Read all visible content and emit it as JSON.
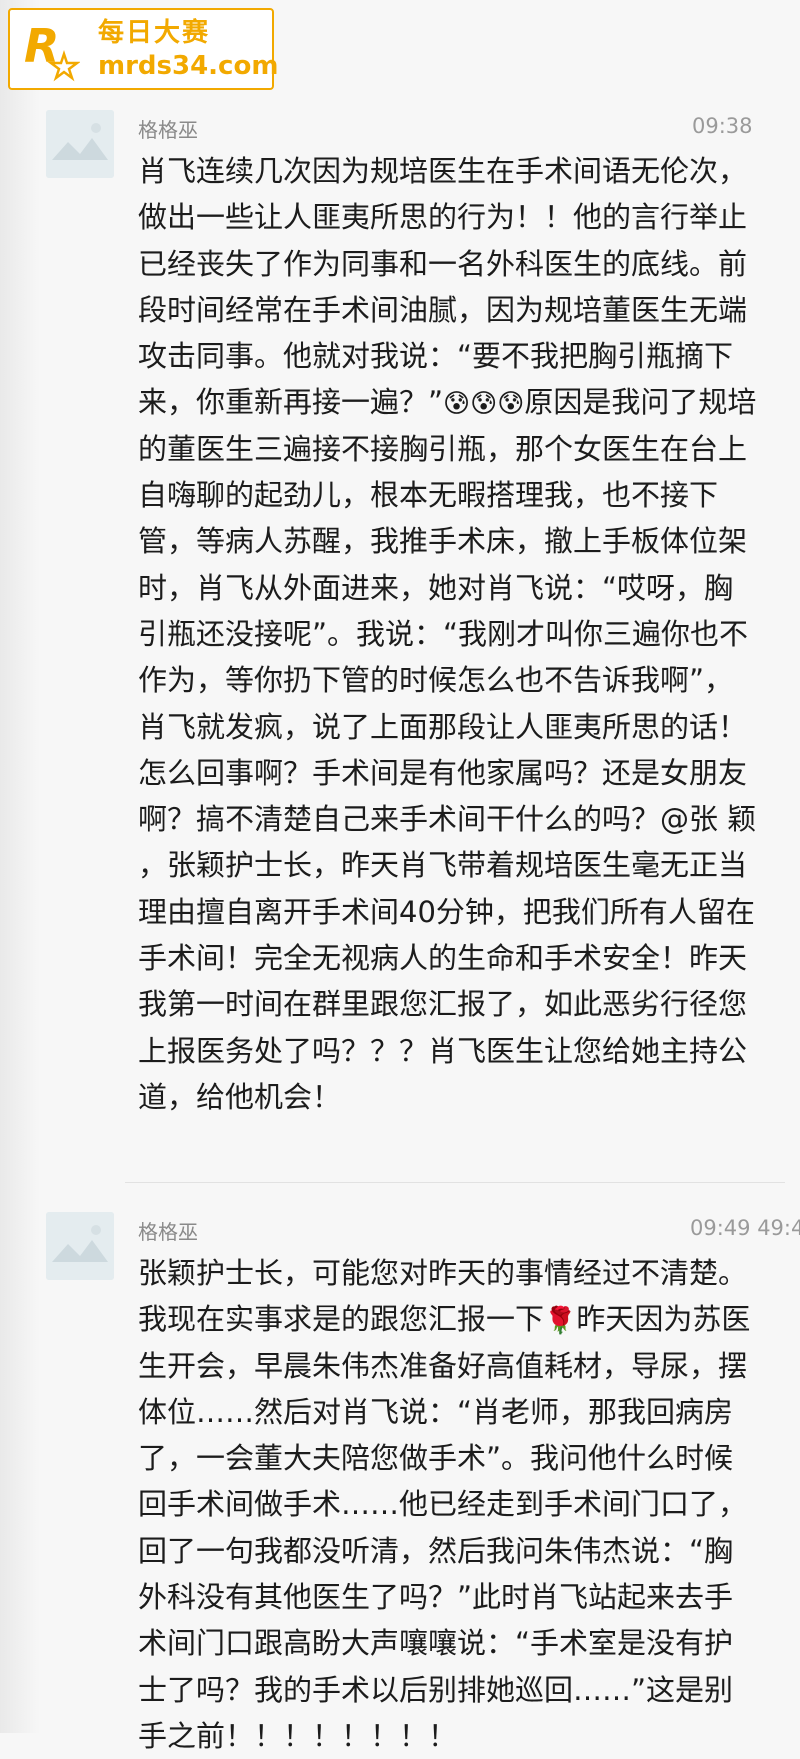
{
  "watermark": {
    "title": "每日大赛",
    "url": "mrds34.com"
  },
  "messages": [
    {
      "sender": "格格巫",
      "time": "09:38",
      "text_1": "肖飞连续几次因为规培医生在手术间语无伦次，做出一些让人匪夷所思的行为！！他的言行举止已经丧失了作为同事和一名外科医生的底线。前段时间经常在手术间油腻，因为规培董医生无端攻击同事。他就对我说：“要不我把胸引瓶摘下来，你重新再接一遍？”",
      "emoji": "😰😰😰",
      "text_2": "原因是我问了规培的董医生三遍接不接胸引瓶，那个女医生在台上自嗨聊的起劲儿，根本无暇搭理我，也不接下管，等病人苏醒，我推手术床，撤上手板体位架时，肖飞从外面进来，她对肖飞说：“哎呀，胸引瓶还没接呢”。我说：“我刚才叫你三遍你也不作为，等你扔下管的时候怎么也不告诉我啊”，肖飞就发疯，说了上面那段让人匪夷所思的话！怎么回事啊？手术间是有他家属吗？还是女朋友啊？搞不清楚自己来手术间干什么的吗？@张 颖 ，张颖护士长，昨天肖飞带着规培医生毫无正当理由擅自离开手术间40分钟，把我们所有人留在手术间！完全无视病人的生命和手术安全！昨天我第一时间在群里跟您汇报了，如此恶劣行径您上报医务处了吗？？？肖飞医生让您给她主持公道，给他机会！"
    },
    {
      "sender": "格格巫",
      "time": "09:49 49:4",
      "text_1": "张颖护士长，可能您对昨天的事情经过不清楚。我现在实事求是的跟您汇报一下",
      "emoji": "🌹",
      "text_2": "昨天因为苏医生开会，早晨朱伟杰准备好高值耗材，导尿，摆体位……然后对肖飞说：“肖老师，那我回病房了，一会董大夫陪您做手术”。我问他什么时候回手术间做手术……他已经走到手术间门口了，回了一句我都没听清，然后我问朱伟杰说：“胸外科没有其他医生了吗？”此时肖飞站起来去手术间门口跟高盼大声嚷嚷说：“手术室是没有护士了吗？我的手术以后别排她巡回……”这是别手之前！！！！！！！！"
    }
  ],
  "colors": {
    "watermark": "#f2a900",
    "text": "#1c1c1c",
    "meta": "#8a8a8a",
    "background": "#f7f7f7"
  }
}
